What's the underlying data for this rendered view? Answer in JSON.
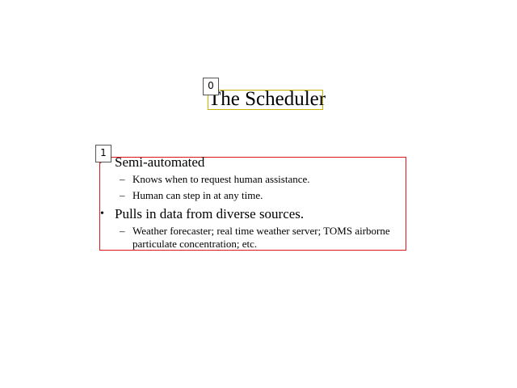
{
  "slide": {
    "title": "The Scheduler",
    "markers": [
      "0",
      "1"
    ],
    "bullets": [
      {
        "symbol": "•",
        "text": "Semi-automated",
        "subitems": [
          "Knows when to request human assistance.",
          "Human can step in at any time."
        ]
      },
      {
        "symbol": "•",
        "text": "Pulls in data from diverse sources.",
        "subitems": [
          "Weather forecaster; real time weather server; TOMS airborne",
          "particulate concentration; etc."
        ]
      }
    ],
    "dash_symbol": "–"
  },
  "colors": {
    "title_box": "#c8b400",
    "body_box": "#e0141c",
    "text": "#000000",
    "background": "#ffffff"
  }
}
